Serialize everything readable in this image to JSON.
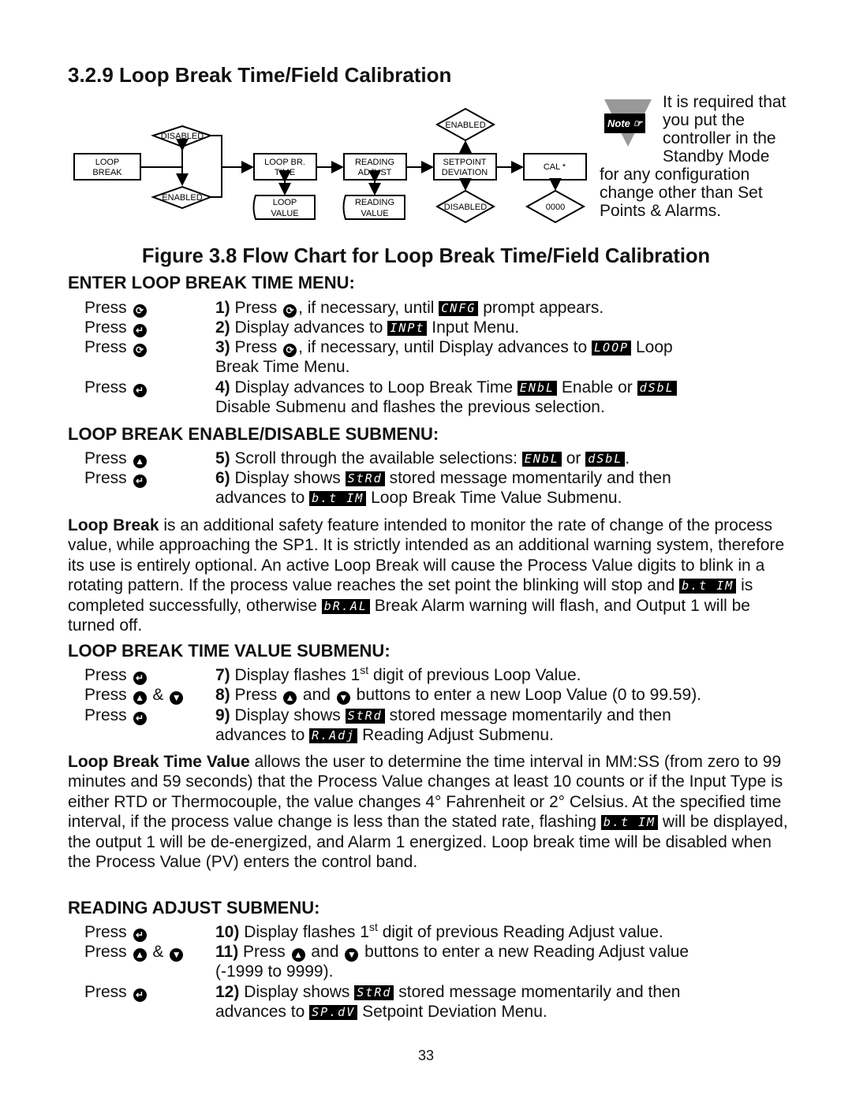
{
  "section_title": "3.2.9 Loop Break Time/Field Calibration",
  "flowchart": {
    "start": {
      "line1": "LOOP",
      "line2": "BREAK"
    },
    "decision_top": "DISABLED",
    "decision_bottom": "ENABLED",
    "loop_br_time": {
      "line1": "LOOP BR.",
      "line2": "TIME"
    },
    "loop_value": {
      "line1": "LOOP",
      "line2": "VALUE"
    },
    "reading_adjust": {
      "line1": "READING",
      "line2": "ADJUST"
    },
    "reading_value": {
      "line1": "READING",
      "line2": "VALUE"
    },
    "setpoint_deviation": {
      "line1": "SETPOINT",
      "line2": "DEVIATION"
    },
    "sp_enabled": "ENABLED",
    "sp_disabled": "DISABLED",
    "cal": "CAL *",
    "cal_value": "0000"
  },
  "note": {
    "tag": "Note",
    "text": "It is required that you put the controller in the Standby Mode for any configuration change other than Set Points & Alarms."
  },
  "figure_caption": "Figure 3.8 Flow Chart for Loop Break Time/Field Calibration",
  "sections": {
    "enter": {
      "heading": "ENTER LOOP BREAK TIME MENU:",
      "steps": [
        {
          "press": "Press",
          "num": "1)",
          "a": "Press",
          "b": ", if necessary, until",
          "lcd": "CNFG",
          "c": "prompt appears."
        },
        {
          "press": "Press",
          "num": "2)",
          "a": "Display advances to",
          "lcd": "INPt",
          "c": "Input Menu."
        },
        {
          "press": "Press",
          "num": "3)",
          "a": "Press",
          "b": ", if necessary, until Display advances to",
          "lcd": "LOOP",
          "c": "Loop",
          "line2": "Break Time Menu."
        },
        {
          "press": "Press",
          "num": "4)",
          "a": "Display advances to Loop Break Time",
          "lcd": "ENbL",
          "b": "Enable or",
          "lcd2": "dSbL",
          "line2": "Disable Submenu and flashes the previous selection."
        }
      ]
    },
    "enable_disable": {
      "heading": "LOOP BREAK ENABLE/DISABLE SUBMENU:",
      "steps": [
        {
          "press": "Press",
          "num": "5)",
          "a": "Scroll through the available selections:",
          "lcd": "ENbL",
          "b": "or",
          "lcd2": "dSbL",
          "c": "."
        },
        {
          "press": "Press",
          "num": "6)",
          "a": "Display shows",
          "lcd": "StRd",
          "c": "stored message momentarily and then",
          "line2a": "advances to",
          "lcd2": "b.t IM",
          "line2b": "Loop Break Time Value Submenu."
        }
      ]
    },
    "loop_break_para": {
      "bold": "Loop Break",
      "text1": " is an additional safety feature intended to monitor the rate of change of the process value, while approaching the SP1. It is strictly intended as an additional warning system, therefore its use is entirely optional. An active Loop Break will cause the Process Value digits to blink in a rotating pattern. If the process value reaches the set point the blinking will stop and ",
      "lcd1": "b.t IM",
      "text2": " is completed successfully, otherwise ",
      "lcd2": "bR.AL",
      "text3": " Break Alarm warning will flash, and Output 1 will be turned off."
    },
    "time_value": {
      "heading": "LOOP BREAK TIME VALUE SUBMENU:",
      "steps": [
        {
          "press": "Press",
          "num": "7)",
          "a": "Display flashes 1",
          "sup": "st",
          "c": "digit of previous Loop Value."
        },
        {
          "press": "Press",
          "amp": "&",
          "num": "8)",
          "a": "Press",
          "b": "and",
          "c": "buttons to enter a new Loop Value (0 to 99.59)."
        },
        {
          "press": "Press",
          "num": "9)",
          "a": "Display shows",
          "lcd": "StRd",
          "c": "stored message momentarily and then",
          "line2a": "advances to",
          "lcd2": "R.Adj",
          "line2b": "Reading Adjust Submenu."
        }
      ]
    },
    "time_value_para": {
      "bold": "Loop Break Time Value",
      "text1": " allows the user to determine the time interval in MM:SS (from zero to 99 minutes and 59 seconds) that the Process Value changes at least 10 counts or if the Input Type is either RTD or Thermocouple, the value changes 4° Fahrenheit or 2° Celsius. At the specified time interval, if the process value change is less than the stated rate, flashing ",
      "lcd1": "b.t IM",
      "text2": " will be displayed, the output 1 will be de-energized, and Alarm 1 energized. Loop break time will be disabled when the Process Value (PV) enters the control band."
    },
    "reading_adjust": {
      "heading": "READING ADJUST SUBMENU:",
      "steps": [
        {
          "press": "Press",
          "num": "10)",
          "a": "Display flashes 1",
          "sup": "st",
          "c": "digit of previous Reading Adjust value."
        },
        {
          "press": "Press",
          "amp": "&",
          "num": "11)",
          "a": "Press",
          "b": "and",
          "c": "buttons to enter a new Reading Adjust value",
          "line2": "(-1999 to 9999)."
        },
        {
          "press": "Press",
          "num": "12)",
          "a": "Display shows",
          "lcd": "StRd",
          "c": "stored message momentarily and then",
          "line2a": "advances to",
          "lcd2": "SP.dV",
          "line2b": "Setpoint Deviation Menu."
        }
      ]
    }
  },
  "icons": {
    "advance": "⟳",
    "enter": "↵",
    "up": "▲",
    "down": "▼"
  },
  "page_number": "33"
}
